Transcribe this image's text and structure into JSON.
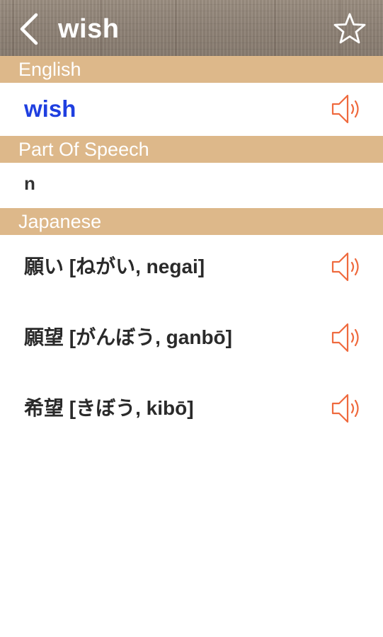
{
  "header": {
    "title": "wish",
    "back_icon": "chevron-left-icon",
    "favorite_icon": "star-outline-icon"
  },
  "sections": {
    "english": {
      "label": "English",
      "word": "wish",
      "speaker_icon": "speaker-icon"
    },
    "part_of_speech": {
      "label": "Part Of Speech",
      "value": "n"
    },
    "japanese": {
      "label": "Japanese",
      "translations": [
        {
          "text": "願い [ねがい, negai]",
          "speaker_icon": "speaker-icon"
        },
        {
          "text": "願望 [がんぼう, ganbō]",
          "speaker_icon": "speaker-icon"
        },
        {
          "text": "希望 [きぼう, kibō]",
          "speaker_icon": "speaker-icon"
        }
      ]
    }
  },
  "colors": {
    "section_header_bg": "#ddb88a",
    "english_word": "#1f3fe0",
    "speaker": "#ef6a3e",
    "header_bg": "#8f8377"
  }
}
